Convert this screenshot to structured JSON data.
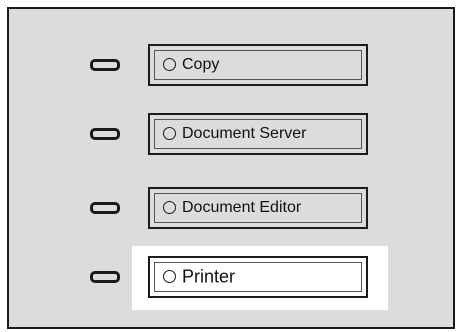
{
  "panel": {
    "buttons": [
      {
        "label": "Copy",
        "active": false
      },
      {
        "label": "Document Server",
        "active": false
      },
      {
        "label": "Document Editor",
        "active": false
      },
      {
        "label": "Printer",
        "active": true
      }
    ]
  },
  "colors": {
    "panel_bg": "#dcdcdc",
    "border": "#1a1a1a",
    "highlight": "#ffffff"
  }
}
